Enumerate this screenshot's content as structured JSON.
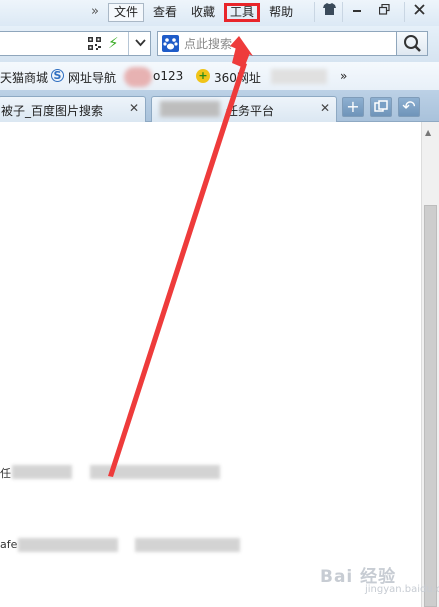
{
  "menu": {
    "more": "»",
    "file": "文件",
    "view": "查看",
    "favorites": "收藏",
    "tools": "工具",
    "help": "帮助"
  },
  "window": {
    "skin_icon": "tshirt-icon",
    "minimize_icon": "minimize-icon",
    "restore_icon": "restore-icon",
    "close_icon": "close-icon"
  },
  "navbar": {
    "search_placeholder": "点此搜索",
    "engine_icon": "paw-icon",
    "search_icon": "magnifier-icon"
  },
  "bookmarks": {
    "items": [
      "天猫商城",
      "网址导航",
      "o123",
      "360网址"
    ],
    "more": "»"
  },
  "tabs": [
    {
      "label": "被子_百度图片搜索"
    },
    {
      "label": "任务平台"
    }
  ],
  "tab_controls": {
    "new_tab": "+",
    "restore_tab": "↶"
  },
  "content": {
    "frag1": "任",
    "frag2": "afe"
  },
  "watermark": {
    "main": "Bai 经验",
    "sub": "jingyan.baidu.com"
  },
  "colors": {
    "highlight": "#e8252a",
    "arrow": "#ee3b3b"
  }
}
